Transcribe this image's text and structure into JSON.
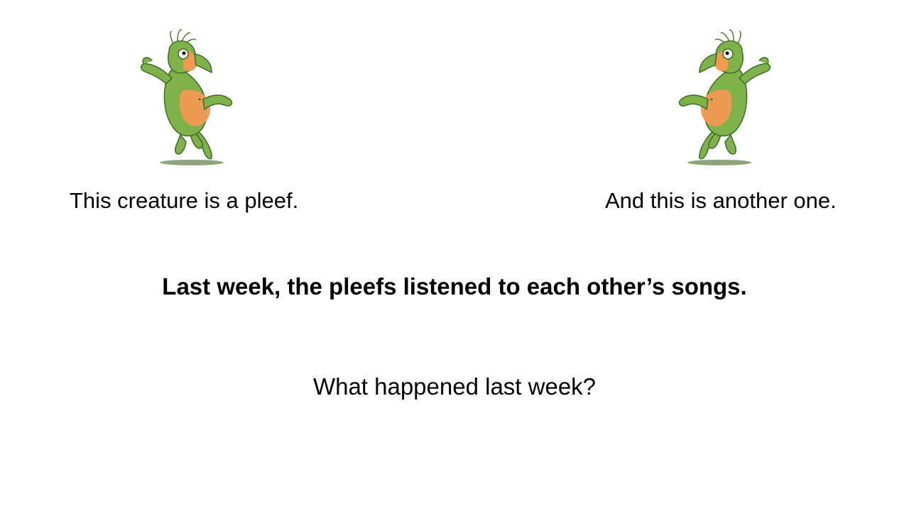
{
  "slide": {
    "left_caption": "This creature is a pleef.",
    "right_caption": "And this is another one.",
    "statement": "Last week, the pleefs listened to each other’s songs.",
    "question": "What happened last week?"
  },
  "illustration": {
    "icon": "pleef-creature-icon",
    "colors": {
      "body": "#7fb24a",
      "outline": "#3f6b2a",
      "belly": "#f39a52",
      "shadow": "#6f8f5a"
    }
  }
}
